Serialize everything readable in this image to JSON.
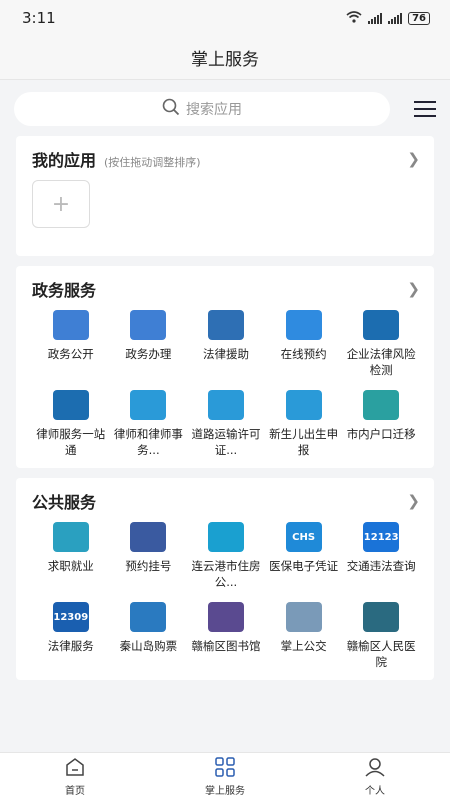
{
  "status": {
    "time": "3:11",
    "battery": "76"
  },
  "header": {
    "title": "掌上服务"
  },
  "search": {
    "placeholder": "搜索应用"
  },
  "my_apps": {
    "title": "我的应用",
    "hint": "(按住拖动调整排序)",
    "add_symbol": "+"
  },
  "gov": {
    "title": "政务服务",
    "items": [
      {
        "label": "政务公开",
        "icon": "gov-open-icon",
        "color": "#3f7fd4"
      },
      {
        "label": "政务办理",
        "icon": "gov-handle-icon",
        "color": "#3f7fd4"
      },
      {
        "label": "法律援助",
        "icon": "handshake-icon",
        "color": "#2e6fb4"
      },
      {
        "label": "在线预约",
        "icon": "clock-icon",
        "color": "#2f8be0"
      },
      {
        "label": "企业法律风险检测",
        "icon": "bulb-icon",
        "color": "#1c6db0"
      },
      {
        "label": "律师服务一站通",
        "icon": "bulb-icon",
        "color": "#1c6db0"
      },
      {
        "label": "律师和律师事务...",
        "icon": "building-icon",
        "color": "#2a9ad8"
      },
      {
        "label": "道路运输许可证...",
        "icon": "document-icon",
        "color": "#2a9ad8"
      },
      {
        "label": "新生儿出生申报",
        "icon": "calendar-baby-icon",
        "color": "#2a9ad8"
      },
      {
        "label": "市内户口迁移",
        "icon": "folder-icon",
        "color": "#2aa0a0"
      }
    ]
  },
  "public": {
    "title": "公共服务",
    "items": [
      {
        "label": "求职就业",
        "icon": "briefcase-icon",
        "color": "#2aa0c0"
      },
      {
        "label": "预约挂号",
        "icon": "hospital-seal-icon",
        "color": "#3a5aa0"
      },
      {
        "label": "连云港市住房公...",
        "icon": "house-icon",
        "color": "#1aa0d0"
      },
      {
        "label": "医保电子凭证",
        "icon": "chs-icon",
        "color": "#1f8ad8",
        "text": "CHS"
      },
      {
        "label": "交通违法查询",
        "icon": "traffic-12123-icon",
        "color": "#1a73d8",
        "text": "12123"
      },
      {
        "label": "法律服务",
        "icon": "law-12309-icon",
        "color": "#1a5fb0",
        "text": "12309"
      },
      {
        "label": "秦山岛购票",
        "icon": "ship-icon",
        "color": "#2a7ac0"
      },
      {
        "label": "赣榆区图书馆",
        "icon": "library-seal-icon",
        "color": "#5a4a90"
      },
      {
        "label": "掌上公交",
        "icon": "bus-photo-icon",
        "color": "#7a9ab8"
      },
      {
        "label": "赣榆区人民医院",
        "icon": "hospital-logo-icon",
        "color": "#2a6a80"
      }
    ]
  },
  "tabbar": {
    "home": "首页",
    "services": "掌上服务",
    "me": "个人"
  }
}
